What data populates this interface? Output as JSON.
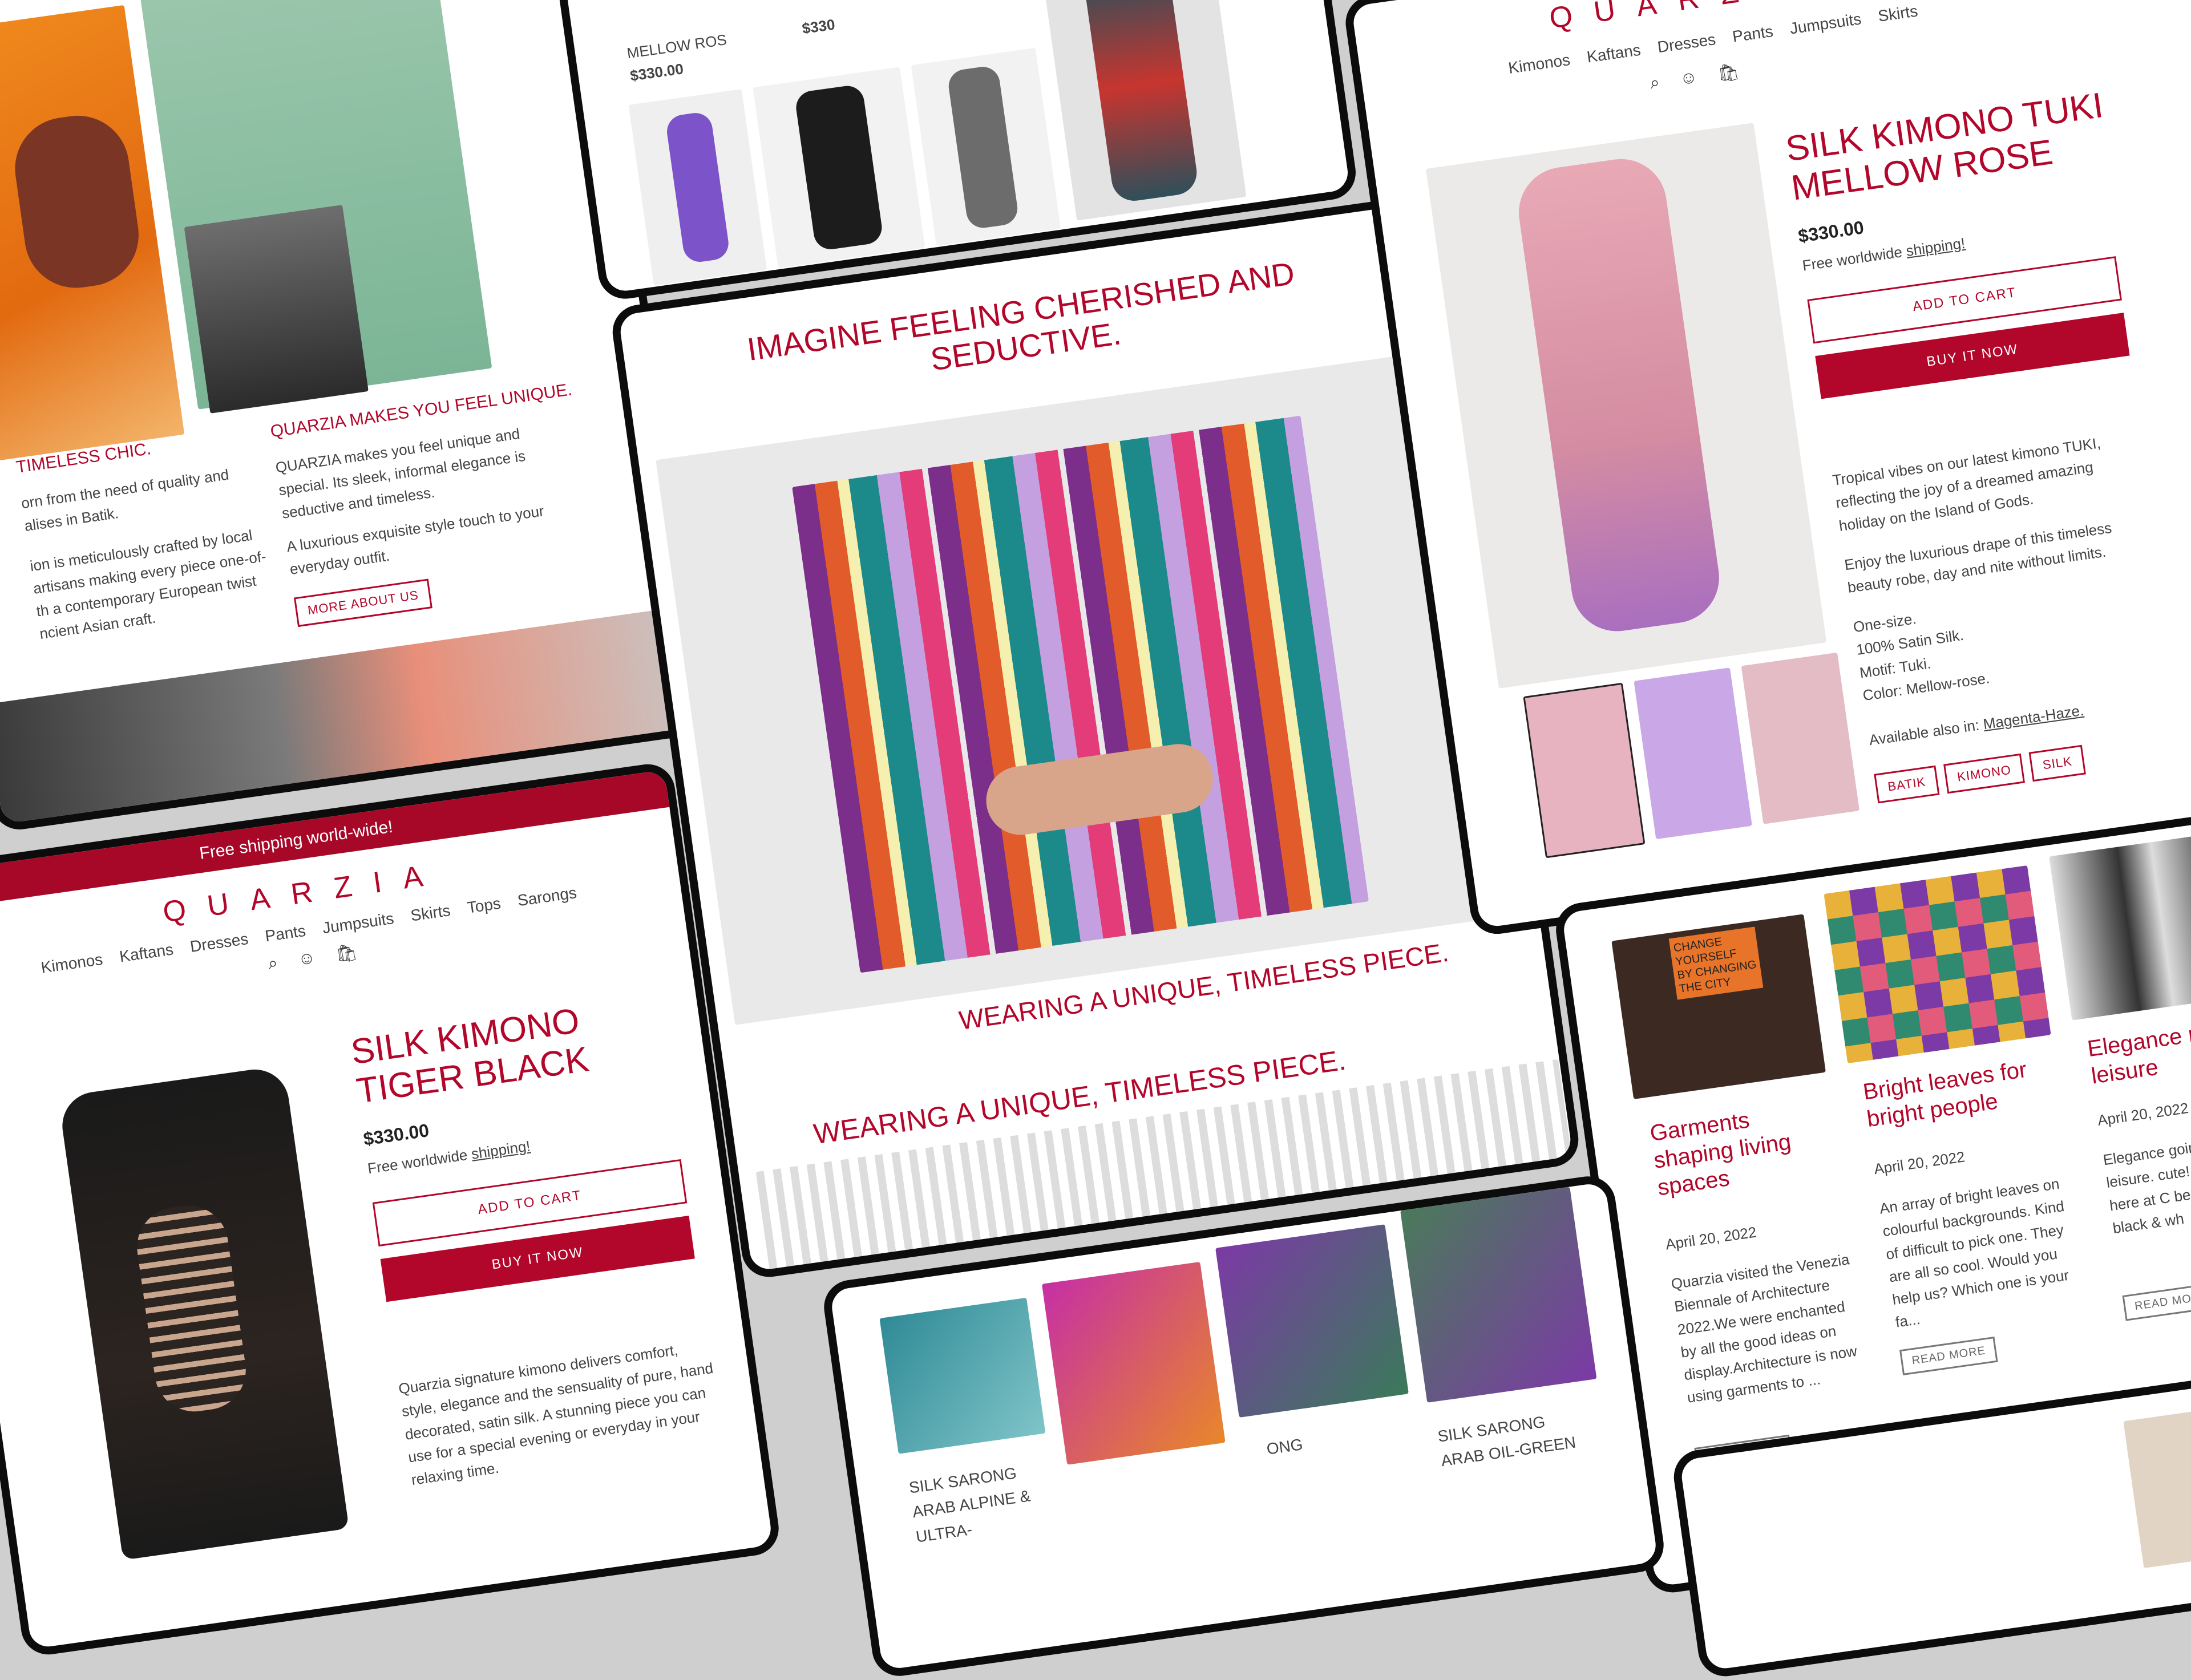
{
  "brand": {
    "logo": "QUARZIA",
    "banner": "Free shipping world-wide!"
  },
  "nav": {
    "items": [
      "Kimonos",
      "Kaftans",
      "Dresses",
      "Pants",
      "Jumpsuits",
      "Skirts",
      "Tops",
      "Sarongs"
    ]
  },
  "icons": {
    "search": "search-icon",
    "account": "user-icon",
    "cart": "cart-icon"
  },
  "about_panel": {
    "left_heading": "TIMELESS CHIC.",
    "left_lines": [
      "orn from the need of quality and",
      "alises in Batik.",
      "ion is meticulously crafted by local",
      "artisans making every piece one-of-",
      "th a contemporary European twist",
      "ncient Asian craft."
    ],
    "right_heading": "QUARZIA MAKES YOU FEEL UNIQUE.",
    "right_text": "QUARZIA makes you feel unique and special. Its sleek, informal elegance is seductive and timeless.",
    "right_text2": "A luxurious exquisite style touch to your everyday outfit.",
    "button": "MORE ABOUT US"
  },
  "top_center": {
    "product_name": "MELLOW ROS",
    "price": "$330.00",
    "price2": "$330"
  },
  "hero": {
    "headline": "IMAGINE FEELING CHERISHED AND SEDUCTIVE.",
    "subheadline": "WEARING A UNIQUE, TIMELESS PIECE.",
    "caption": "WEARING A UNIQUE, TIMELESS PIECE."
  },
  "product_tuki": {
    "title": "SILK KIMONO TUKI MELLOW ROSE",
    "price": "$330.00",
    "shipping_prefix": "Free worldwide ",
    "shipping_link": "shipping!",
    "add_to_cart": "ADD TO CART",
    "buy_now": "BUY IT NOW",
    "desc1": "Tropical vibes on our latest kimono TUKI, reflecting the joy of a dreamed amazing holiday on the Island of Gods.",
    "desc2": "Enjoy the luxurious drape of this timeless beauty robe, day and nite without limits.",
    "specs": [
      "One-size.",
      "100% Satin Silk.",
      "Motif: Tuki.",
      "Color: Mellow-rose."
    ],
    "available_prefix": "Available also in: ",
    "available_link": "Magenta-Haze.",
    "tags": [
      "BATIK",
      "KIMONO",
      "SILK"
    ]
  },
  "product_tiger": {
    "title": "SILK KIMONO TIGER BLACK",
    "price": "$330.00",
    "shipping_prefix": "Free worldwide ",
    "shipping_link": "shipping!",
    "add_to_cart": "ADD TO CART",
    "buy_now": "BUY IT NOW",
    "desc": "Quarzia signature kimono delivers comfort, style, elegance and the sensuality of pure, hand decorated, satin silk. A stunning piece you can use for a special evening or everyday in your relaxing time."
  },
  "blog": {
    "posts": [
      {
        "title": "Garments shaping living spaces",
        "date": "April 20, 2022",
        "excerpt": "Quarzia visited the Venezia Biennale of Architecture 2022.We were enchanted by all the good ideas on display.Architecture is now using garments to ...",
        "button": "READ MORE",
        "image_text": "CHANGE YOURSELF BY CHANGING THE CITY"
      },
      {
        "title": "Bright leaves for bright people",
        "date": "April 20, 2022",
        "excerpt": "An array of bright leaves on colourful backgrounds. Kind of difficult to pick one. They are all so cool. Would you help us? Which one is your fa...",
        "button": "READ MORE"
      },
      {
        "title": "Elegance m leisure",
        "date": "April 20, 2022",
        "excerpt": "Elegance goin with leisure. cute! That's us here at C beautiful D black & wh",
        "button": "READ MO"
      }
    ]
  },
  "sarongs": {
    "items": [
      {
        "name": "SILK SARONG ARAB ALPINE & ULTRA-"
      },
      {
        "name": "ONG"
      },
      {
        "name": "SILK SARONG ARAB OIL-GREEN"
      }
    ]
  },
  "colors": {
    "accent": "#b2062a",
    "frame": "#0c0c0c",
    "background": "#cfcfcf"
  }
}
